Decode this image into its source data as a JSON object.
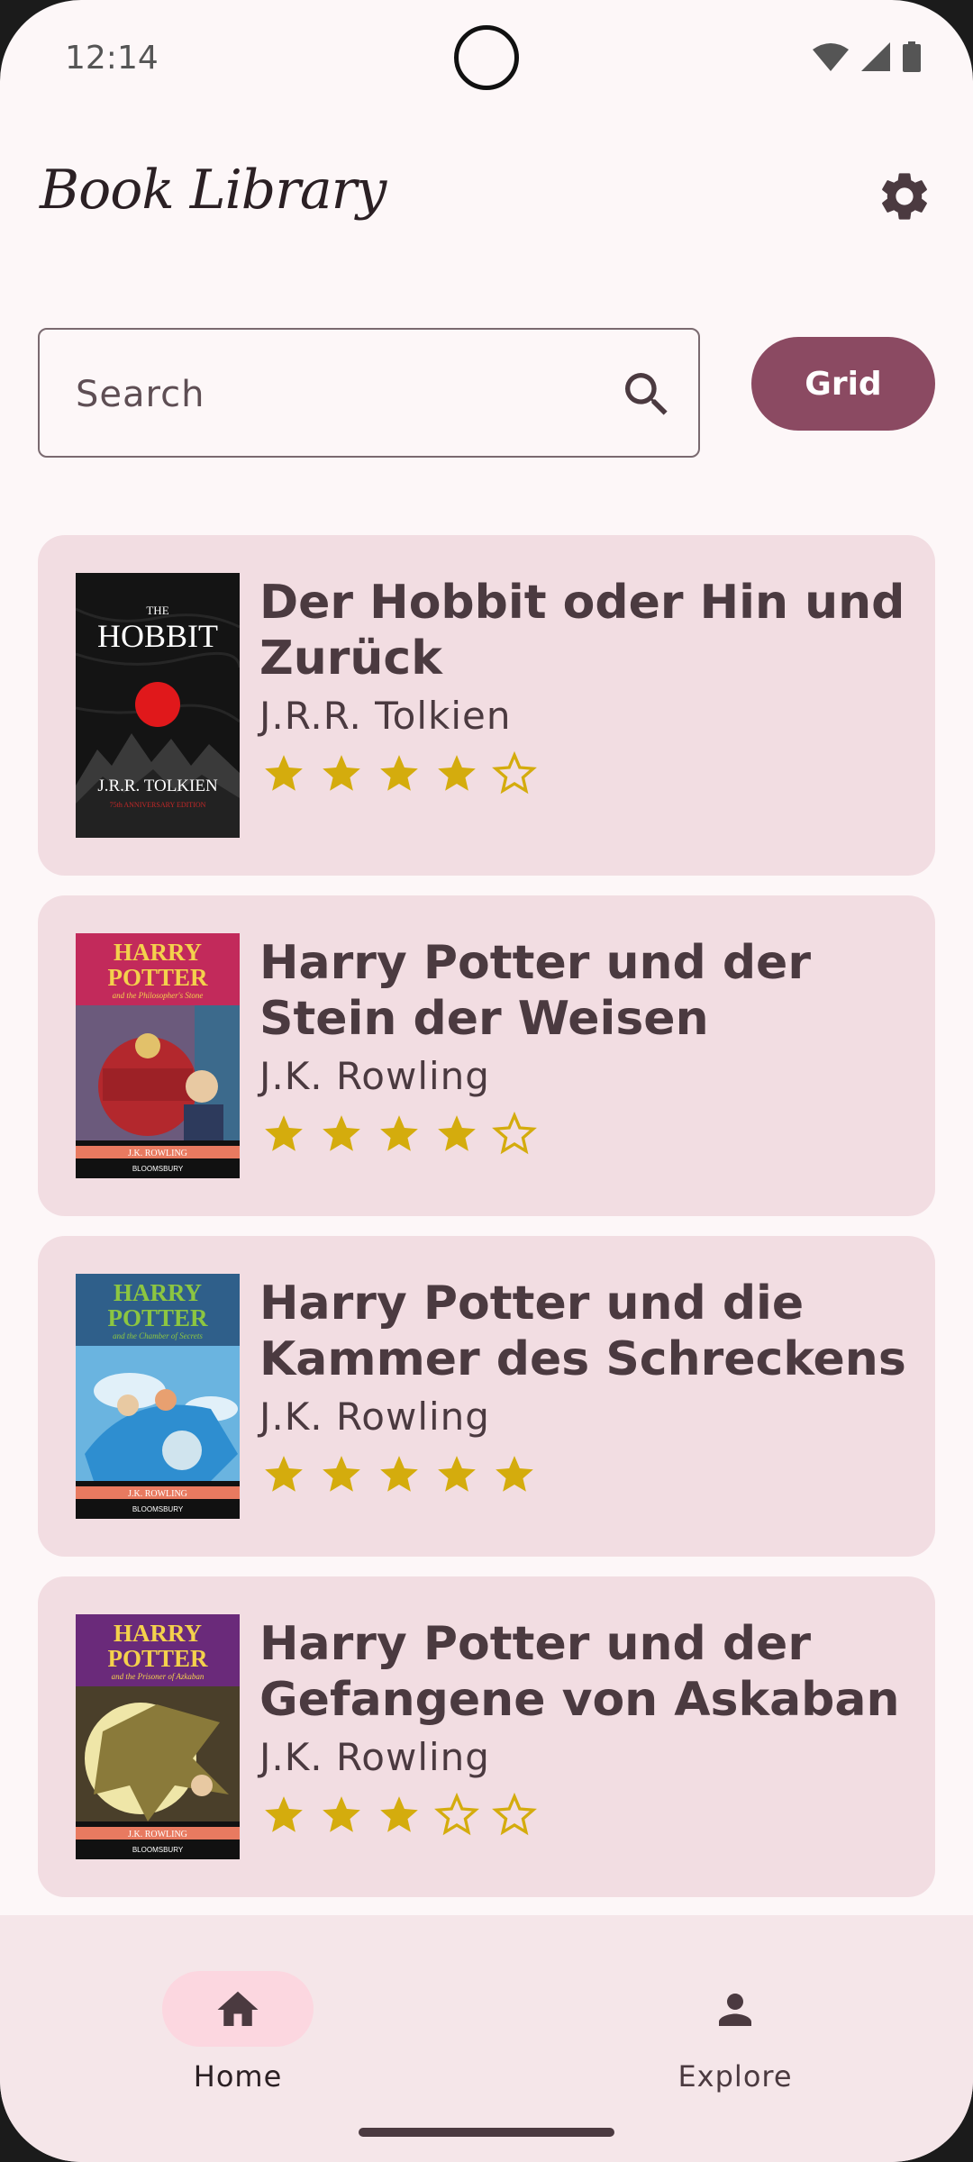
{
  "status_bar": {
    "time": "12:14"
  },
  "header": {
    "title": "Book Library",
    "settings_icon": "gear-icon"
  },
  "search": {
    "placeholder": "Search",
    "value": "",
    "button_label": "Grid"
  },
  "colors": {
    "primary": "#8b4a62",
    "card": "#f2dde2",
    "star": "#d4ac0d",
    "nav_active": "#fcd7e0"
  },
  "books": [
    {
      "title": "Der Hobbit oder Hin und Zurück",
      "author": "J.R.R. Tolkien",
      "rating": 4,
      "cover": {
        "top": "THE",
        "title": "HOBBIT",
        "author": "J.R.R. TOLKIEN",
        "note": "75th ANNIVERSARY EDITION"
      }
    },
    {
      "title": "Harry Potter und der Stein der Weisen",
      "author": "J.K. Rowling",
      "rating": 4,
      "cover": {
        "line1": "HARRY",
        "line2": "POTTER",
        "sub": "and the Philosopher's Stone",
        "author": "J.K. ROWLING",
        "publisher": "BLOOMSBURY"
      }
    },
    {
      "title": "Harry Potter und die Kammer des Schreckens",
      "author": "J.K. Rowling",
      "rating": 5,
      "cover": {
        "line1": "HARRY",
        "line2": "POTTER",
        "sub": "and the Chamber of Secrets",
        "author": "J.K. ROWLING",
        "publisher": "BLOOMSBURY"
      }
    },
    {
      "title": "Harry Potter und der Gefangene von Askaban",
      "author": "J.K. Rowling",
      "rating": 3,
      "cover": {
        "line1": "HARRY",
        "line2": "POTTER",
        "sub": "and the Prisoner of Azkaban",
        "author": "J.K. ROWLING",
        "publisher": "BLOOMSBURY"
      }
    }
  ],
  "nav": [
    {
      "label": "Home",
      "icon": "home-icon",
      "active": true
    },
    {
      "label": "Explore",
      "icon": "person-icon",
      "active": false
    }
  ]
}
